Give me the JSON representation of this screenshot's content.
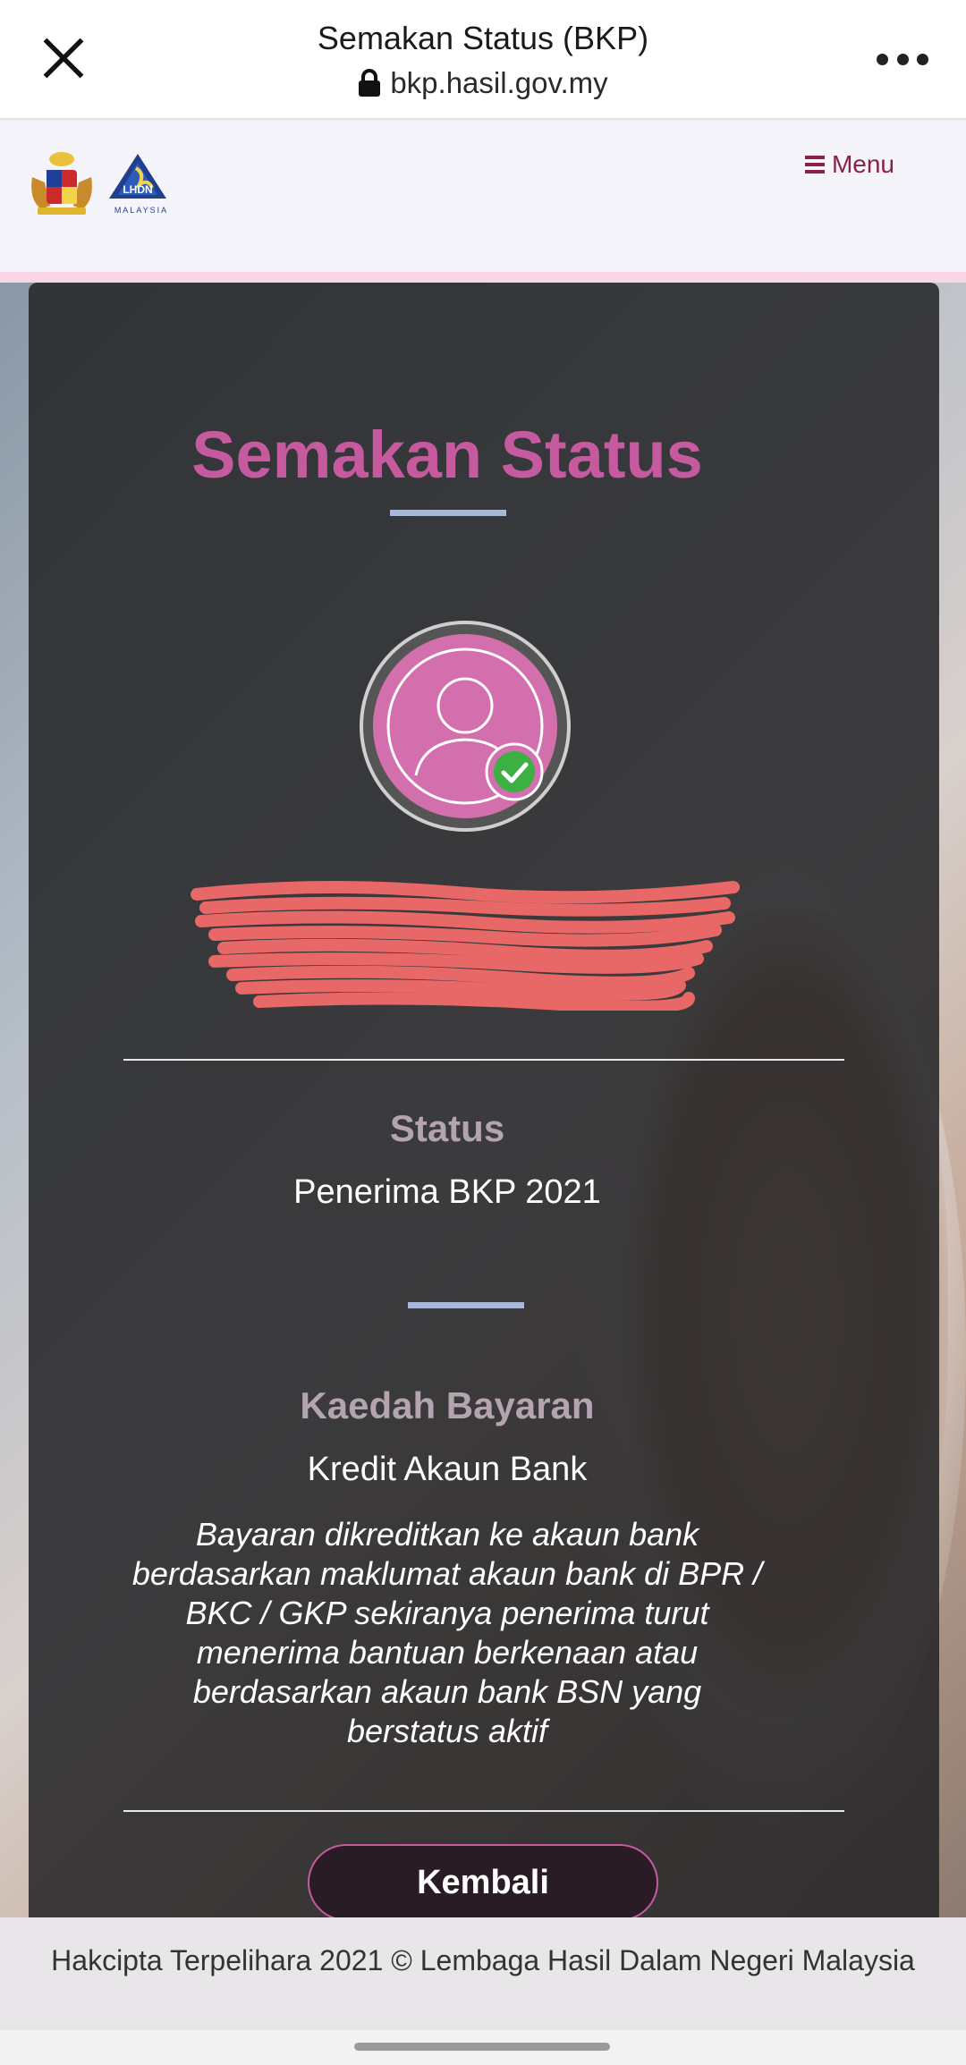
{
  "browser": {
    "title": "Semakan Status (BKP)",
    "url": "bkp.hasil.gov.my"
  },
  "site": {
    "menu_label": "Menu",
    "lhdn_logo_text": "LHDN",
    "lhdn_logo_subtext": "MALAYSIA"
  },
  "main": {
    "title": "Semakan Status",
    "recipient": {
      "name_redacted": "",
      "id_redacted": ""
    },
    "status_label": "Status",
    "status_value": "Penerima BKP 2021",
    "method_label": "Kaedah Bayaran",
    "method_value": "Kredit Akaun Bank",
    "method_note": "Bayaran dikreditkan ke akaun bank berdasarkan maklumat akaun bank di BPR / BKC / GKP sekiranya penerima turut menerima bantuan berkenaan atau berdasarkan akaun bank BSN yang berstatus aktif",
    "back_button": "Kembali"
  },
  "footer": {
    "copyright": "Hakcipta Terpelihara 2021 © Lembaga Hasil Dalam Negeri Malaysia"
  },
  "colors": {
    "accent_pink": "#c65a9e",
    "avatar_pink": "#d46fae",
    "menu_maroon": "#8a2343",
    "rule_blue": "#a8b8d8",
    "verified_green": "#3cb043"
  },
  "icons": {
    "close": "close-icon",
    "lock": "lock-icon",
    "more": "more-icon",
    "menu": "hamburger-menu-icon",
    "avatar": "user-avatar-icon",
    "verified": "check-circle-icon"
  }
}
